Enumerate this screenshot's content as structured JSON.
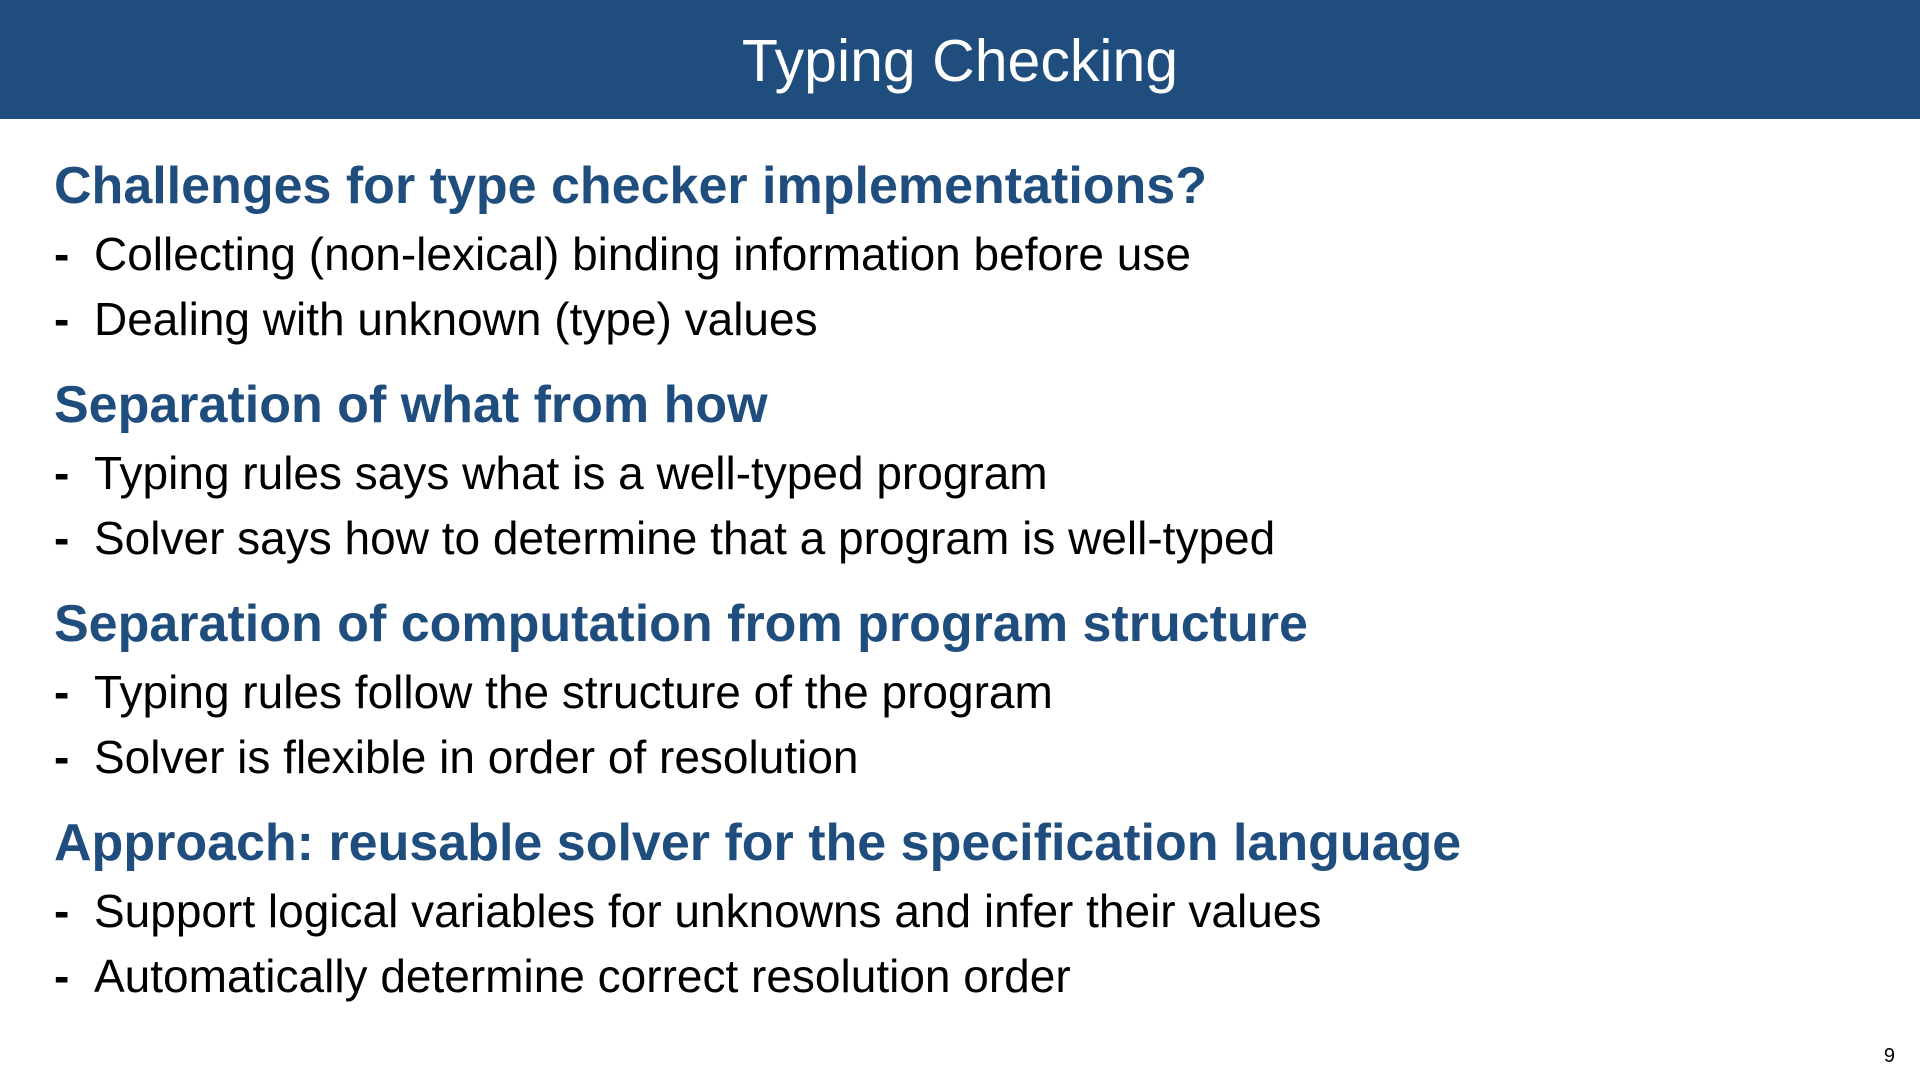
{
  "slide": {
    "title": "Typing Checking",
    "page_number": "9",
    "colors": {
      "title_bar": "#1f4d7d",
      "heading": "#1f4d7d",
      "body": "#000000"
    }
  },
  "sections": [
    {
      "heading": "Challenges for type checker implementations?",
      "bullets": [
        "Collecting (non-lexical) binding information before use",
        "Dealing with unknown (type) values"
      ]
    },
    {
      "heading": "Separation of what from how",
      "bullets": [
        "Typing rules says what is a well-typed program",
        "Solver says how to determine that a program is well-typed"
      ]
    },
    {
      "heading": "Separation of computation from program structure",
      "bullets": [
        "Typing rules follow the structure of the program",
        "Solver is flexible in order of resolution"
      ]
    },
    {
      "heading": "Approach: reusable solver for the specification language",
      "bullets": [
        "Support logical variables for unknowns and infer their values",
        "Automatically determine correct resolution order"
      ]
    }
  ],
  "bullet_marker": "-"
}
